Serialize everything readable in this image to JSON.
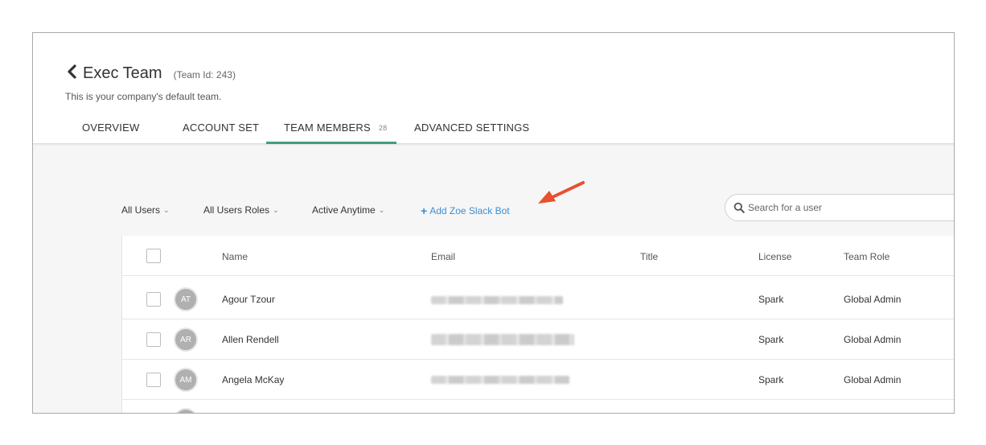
{
  "header": {
    "title": "Exec Team",
    "team_id": "(Team Id: 243)",
    "subtitle": "This is your company's default team."
  },
  "tabs": [
    {
      "label": "OVERVIEW"
    },
    {
      "label": "ACCOUNT SET"
    },
    {
      "label": "TEAM MEMBERS",
      "count": "28",
      "active": true
    },
    {
      "label": "ADVANCED SETTINGS"
    }
  ],
  "toolbar": {
    "filter_users": "All Users",
    "filter_roles": "All Users Roles",
    "filter_activity": "Active Anytime",
    "add_bot": "Add Zoe Slack Bot",
    "search_placeholder": "Search for a user"
  },
  "table": {
    "columns": {
      "name": "Name",
      "email": "Email",
      "title": "Title",
      "license": "License",
      "role": "Team Role"
    },
    "rows": [
      {
        "initials": "AT",
        "name": "Agour Tzour",
        "title": "",
        "license": "Spark",
        "role": "Global Admin"
      },
      {
        "initials": "AR",
        "name": "Allen Rendell",
        "title": "",
        "license": "Spark",
        "role": "Global Admin"
      },
      {
        "initials": "AM",
        "name": "Angela McKay",
        "title": "",
        "license": "Spark",
        "role": "Global Admin"
      }
    ]
  },
  "colors": {
    "accent_tab": "#3f9e84",
    "link": "#3b8fd6",
    "arrow": "#e8502e",
    "avatar": "#b0b0b0"
  }
}
